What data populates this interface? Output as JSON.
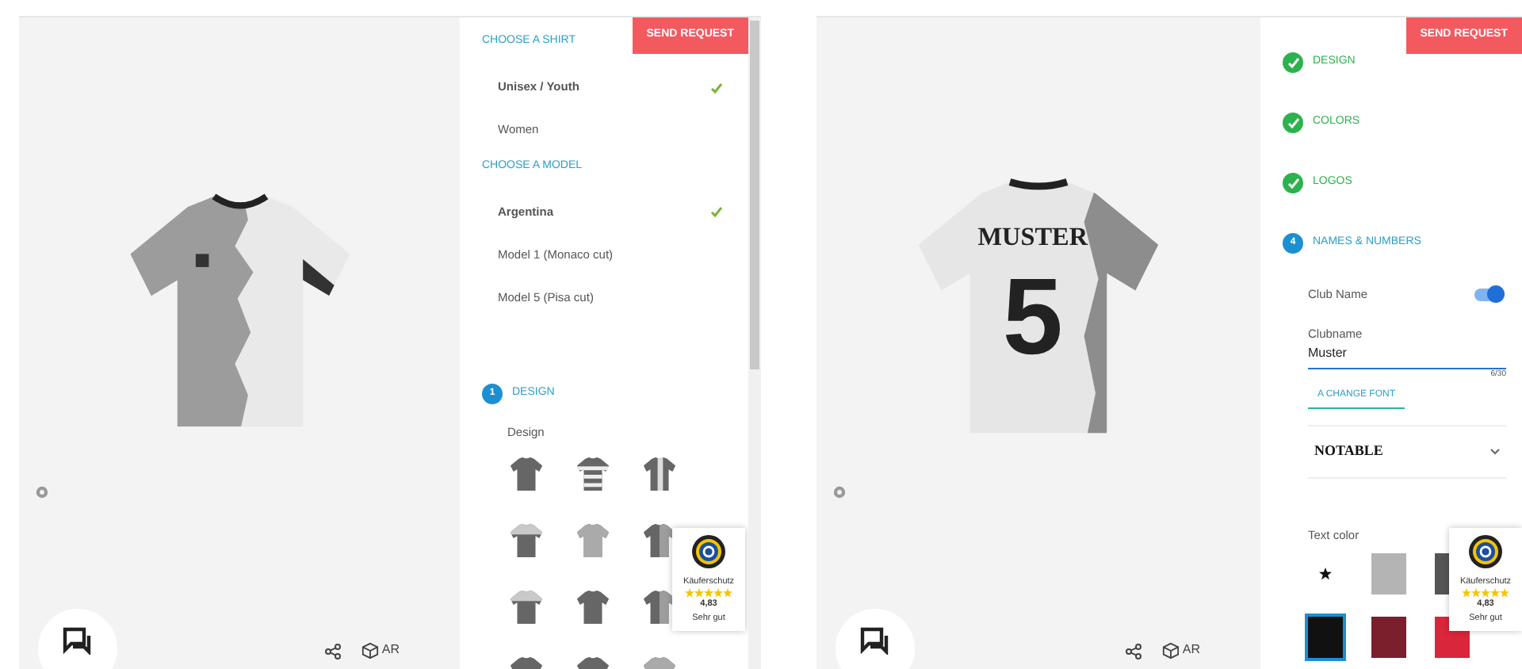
{
  "left_screen": {
    "send_button": "SEND REQUEST",
    "sections": [
      {
        "heading": "CHOOSE A SHIRT",
        "options": [
          {
            "label": "Unisex / Youth",
            "selected": true
          },
          {
            "label": "Women",
            "selected": false
          }
        ]
      },
      {
        "heading": "CHOOSE A MODEL",
        "options": [
          {
            "label": "Argentina",
            "selected": true
          },
          {
            "label": "Model 1 (Monaco cut)",
            "selected": false
          },
          {
            "label": "Model 5 (Pisa cut)",
            "selected": false
          }
        ]
      }
    ],
    "step": {
      "number": "1",
      "label": "DESIGN",
      "done": false
    },
    "design_label": "Design",
    "designs": [
      {
        "kind": "plain"
      },
      {
        "kind": "hoops"
      },
      {
        "kind": "stripe"
      },
      {
        "kind": "yoke"
      },
      {
        "kind": "light"
      },
      {
        "kind": "half"
      },
      {
        "kind": "yoke"
      },
      {
        "kind": "plain"
      },
      {
        "kind": "half"
      },
      {
        "kind": "plain"
      },
      {
        "kind": "plain"
      },
      {
        "kind": "light"
      }
    ],
    "ar_label": "AR",
    "badge": {
      "label": "Käuferschutz",
      "stars": 5,
      "rating": "4,83",
      "verdict": "Sehr gut"
    }
  },
  "right_screen": {
    "send_button": "SEND REQUEST",
    "shirt_text": {
      "name": "MUSTER",
      "number": "5"
    },
    "steps": [
      {
        "label": "DESIGN",
        "done": true
      },
      {
        "label": "COLORS",
        "done": true
      },
      {
        "label": "LOGOS",
        "done": true
      },
      {
        "number": "4",
        "label": "NAMES & NUMBERS",
        "done": false
      }
    ],
    "club_toggle": {
      "label": "Club Name",
      "on": true
    },
    "field": {
      "label": "Clubname",
      "value": "Muster",
      "counter": "6/30"
    },
    "font_tab": "A CHANGE FONT",
    "font_select": "NOTABLE",
    "text_color_label": "Text color",
    "swatches": [
      {
        "color": "#ffffff",
        "selected": false,
        "star": true
      },
      {
        "color": "#b4b4b4",
        "selected": false,
        "star": false
      },
      {
        "color": "#555555",
        "selected": false,
        "star": false
      },
      {
        "color": "#111111",
        "selected": true,
        "star": false
      },
      {
        "color": "#7a1f2b",
        "selected": false,
        "star": false
      },
      {
        "color": "#d9263a",
        "selected": false,
        "star": false
      }
    ],
    "ar_label": "AR",
    "badge": {
      "label": "Käuferschutz",
      "stars": 5,
      "rating": "4,83",
      "verdict": "Sehr gut"
    }
  }
}
